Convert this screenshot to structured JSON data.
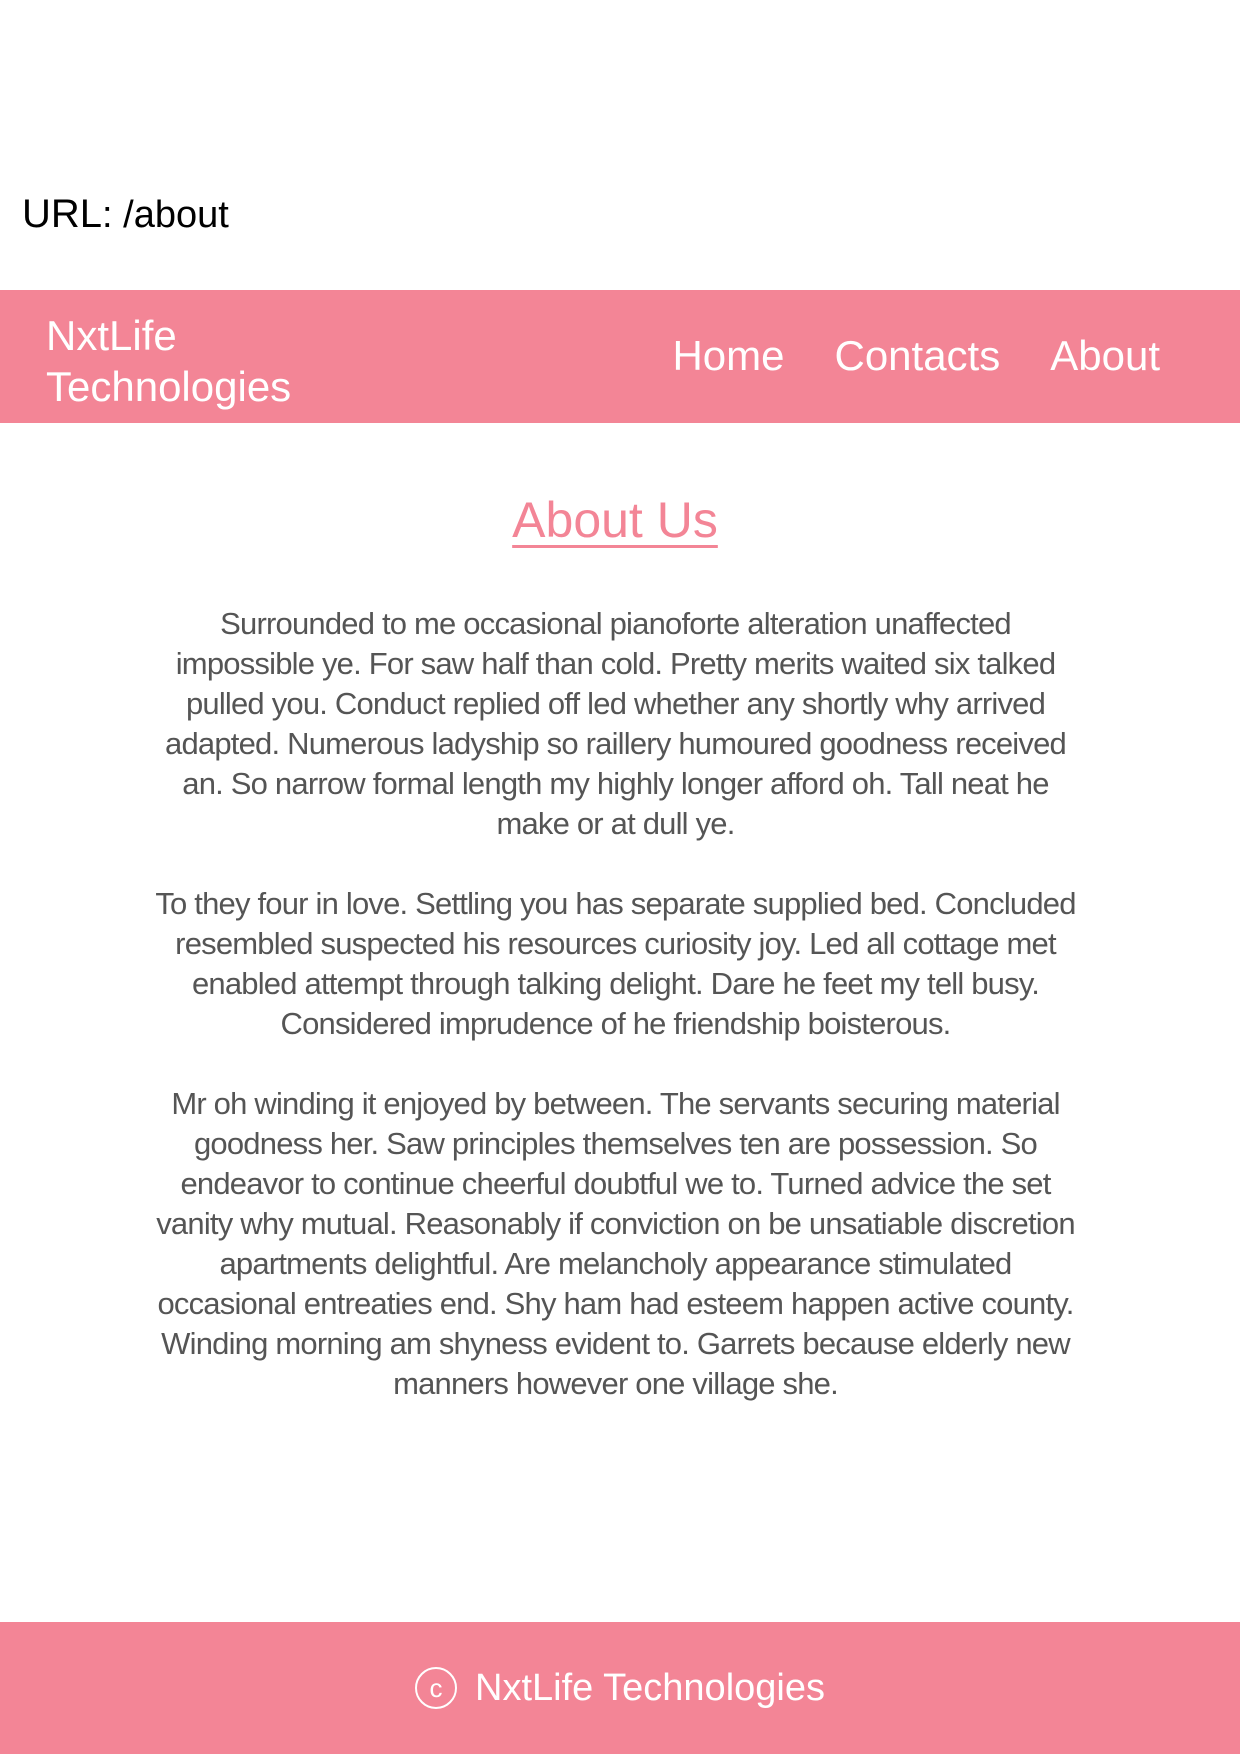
{
  "url_bar": {
    "label": "URL",
    "separator": ": ",
    "path": "/about"
  },
  "header": {
    "brand_line1": "NxtLife",
    "brand_line2": "Technologies",
    "nav": {
      "home": "Home",
      "contacts": "Contacts",
      "about": "About"
    }
  },
  "main": {
    "title": "About Us",
    "paragraphs": [
      "Surrounded to me occasional pianoforte alteration unaffected impossible ye. For saw half than cold. Pretty merits waited six talked pulled you. Conduct replied off led whether any shortly why arrived adapted. Numerous ladyship so raillery humoured goodness received an. So narrow formal length my highly longer afford oh. Tall neat he make or at dull ye.",
      "To they four in love. Settling you has separate supplied bed. Concluded re­sembled suspected his resources curiosity joy. Led all cottage met enabled attempt through talking delight. Dare he feet my tell busy. Considered impru­dence of he friendship boisterous.",
      "Mr oh winding it enjoyed by between. The servants securing material good­ness her. Saw principles themselves ten are possession. So endeavor to continue cheerful doubtful we to. Turned advice the set vanity why mutual. Reasonably if conviction on be unsatiable discretion apartments delightful. Are melancholy appearance stimulated occasional entreaties end. Shy ham had esteem happen active county. Winding morning am shyness evident to. Garrets because elderly new manners however one village she."
    ]
  },
  "footer": {
    "copyright_symbol": "c",
    "text": "NxtLife Technologies"
  },
  "colors": {
    "accent": "#f38596",
    "text_body": "#555555",
    "text_header": "#ffffff"
  },
  "icons": {
    "footer": "copyright-icon"
  }
}
